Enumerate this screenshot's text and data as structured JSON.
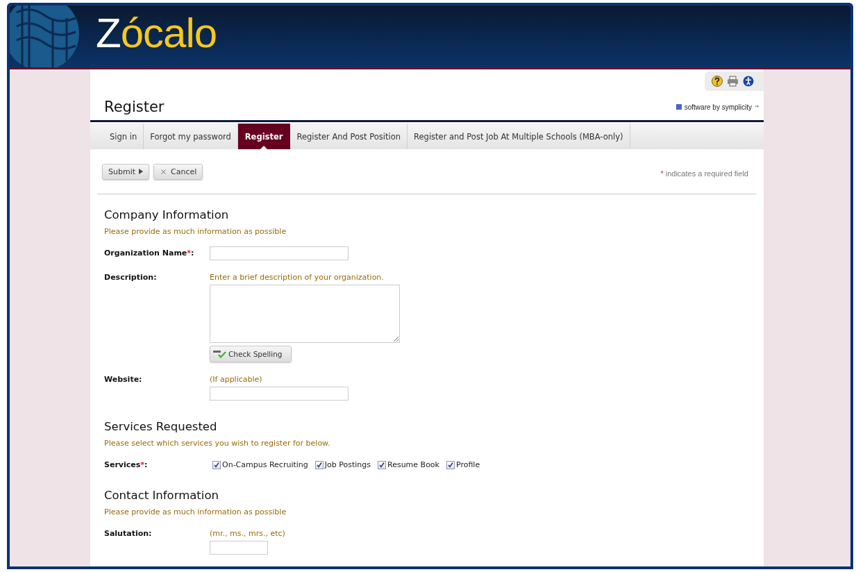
{
  "header": {
    "logo": {
      "initial": "Z",
      "rest": "ócalo"
    }
  },
  "page": {
    "title": "Register",
    "vendor": "software by symplicity",
    "vendor_mark": "™"
  },
  "tabs": [
    {
      "label": "Sign in",
      "selected": false
    },
    {
      "label": "Forgot my password",
      "selected": false
    },
    {
      "label": "Register",
      "selected": true
    },
    {
      "label": "Register And Post Position",
      "selected": false
    },
    {
      "label": "Register and Post Job At Multiple Schools (MBA-only)",
      "selected": false
    }
  ],
  "actions": {
    "submit": "Submit",
    "cancel": "Cancel",
    "required_note": {
      "mark": "*",
      "text": "indicates a required field"
    }
  },
  "sections": [
    {
      "title": "Company Information",
      "hint": "Please provide as much information as possible",
      "fields": [
        {
          "kind": "text",
          "label": "Organization Name",
          "mark": "*",
          "tail": ":"
        },
        {
          "kind": "textarea",
          "label": "Description:",
          "note": "Enter a brief description of your organization.",
          "button": "Check Spelling"
        },
        {
          "kind": "text",
          "label": "Website:",
          "note": "(If applicable)"
        }
      ]
    },
    {
      "title": "Services Requested",
      "hint": "Please select which services you wish to register for below.",
      "fields": [
        {
          "kind": "checks",
          "label": "Services",
          "mark": "*",
          "tail": ":",
          "options": [
            {
              "label": "On-Campus Recruiting",
              "checked": true
            },
            {
              "label": "Job Postings",
              "checked": true
            },
            {
              "label": "Resume Book",
              "checked": true
            },
            {
              "label": "Profile",
              "checked": true
            }
          ]
        }
      ]
    },
    {
      "title": "Contact Information",
      "hint": "Please provide as much information as possible",
      "fields": [
        {
          "kind": "short-text",
          "label": "Salutation:",
          "note": "(mr., ms., mrs., etc)"
        }
      ]
    }
  ]
}
